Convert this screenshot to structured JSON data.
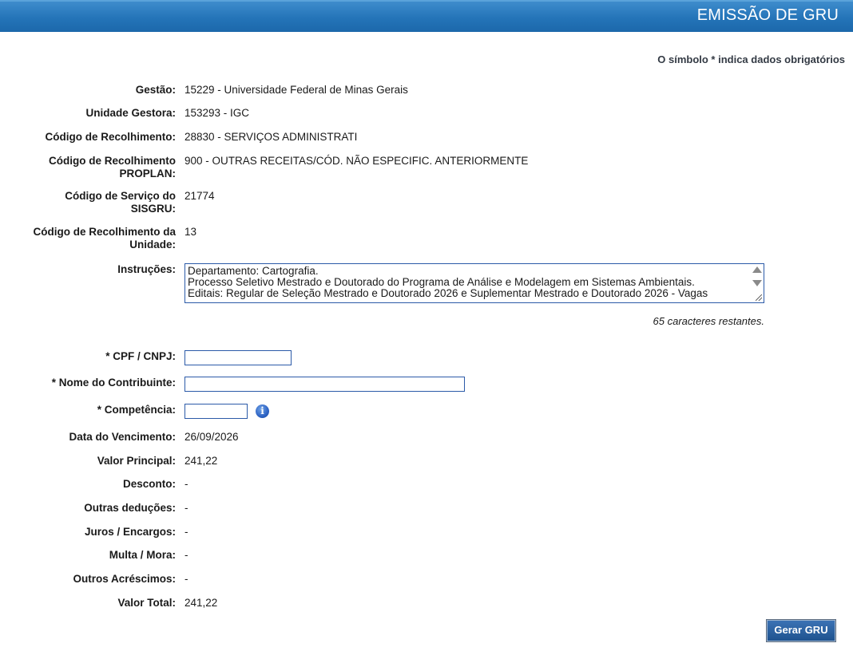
{
  "header": {
    "title": "EMISSÃO DE GRU"
  },
  "required_note": "O símbolo * indica dados obrigatórios",
  "fields": {
    "gestao": {
      "label": "Gestão:",
      "value": "15229 - Universidade Federal de Minas Gerais"
    },
    "unidade_gestora": {
      "label": "Unidade Gestora:",
      "value": "153293 - IGC"
    },
    "codigo_recolhimento": {
      "label": "Código de Recolhimento:",
      "value": "28830 - SERVIÇOS ADMINISTRATI"
    },
    "codigo_recolhimento_proplan": {
      "label_line1": "Código de Recolhimento",
      "label_line2": "PROPLAN:",
      "value": "900 - OUTRAS RECEITAS/CÓD. NÃO ESPECIFIC. ANTERIORMENTE"
    },
    "codigo_servico_sisgru": {
      "label_line1": "Código de Serviço do",
      "label_line2": "SISGRU:",
      "value": "21774"
    },
    "codigo_recolhimento_unidade": {
      "label_line1": "Código de Recolhimento da",
      "label_line2": "Unidade:",
      "value": "13"
    },
    "instrucoes": {
      "label": "Instruções:",
      "line1": "Departamento: Cartografia.",
      "line2": "Processo Seletivo Mestrado e Doutorado do Programa de Análise e Modelagem em Sistemas Ambientais.",
      "line3": "Editais:  Regular de Seleção Mestrado e Doutorado 2026 e Suplementar Mestrado e Doutorado 2026 - Vagas",
      "chars_left": "65 caracteres restantes."
    },
    "cpf_cnpj": {
      "label": "* CPF / CNPJ:",
      "value": ""
    },
    "nome_contribuinte": {
      "label": "* Nome do Contribuinte:",
      "value": ""
    },
    "competencia": {
      "label": "* Competência:",
      "value": "",
      "info_icon": "info-icon"
    },
    "data_vencimento": {
      "label": "Data do Vencimento:",
      "value": "26/09/2026"
    },
    "valor_principal": {
      "label": "Valor Principal:",
      "value": "241,22"
    },
    "desconto": {
      "label": "Desconto:",
      "value": "-"
    },
    "outras_deducoes": {
      "label": "Outras deduções:",
      "value": "-"
    },
    "juros_encargos": {
      "label": "Juros / Encargos:",
      "value": "-"
    },
    "multa_mora": {
      "label": "Multa / Mora:",
      "value": "-"
    },
    "outros_acrescimos": {
      "label": "Outros Acréscimos:",
      "value": "-"
    },
    "valor_total": {
      "label": "Valor Total:",
      "value": "241,22"
    }
  },
  "buttons": {
    "gerar_gru": "Gerar GRU"
  },
  "colors": {
    "header": "#2474b8",
    "input_border": "#2b5aa8",
    "button": "#1f538f"
  }
}
